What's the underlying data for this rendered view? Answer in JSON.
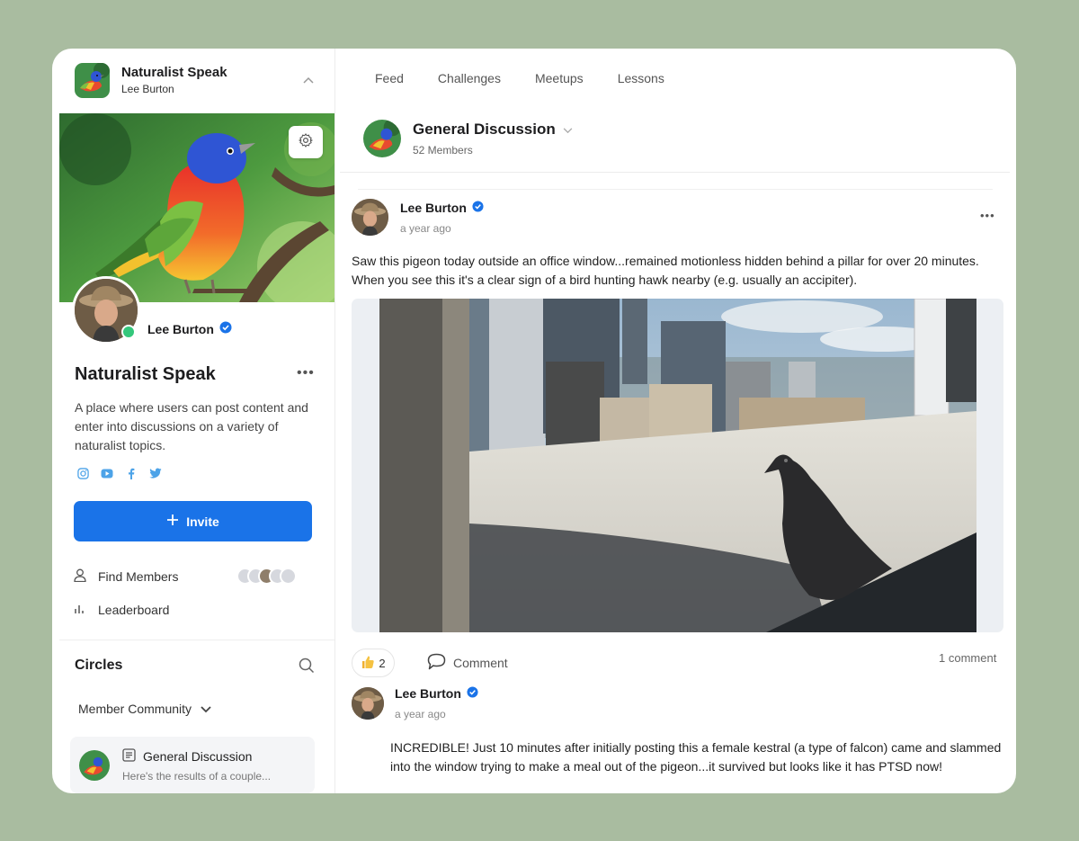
{
  "sidebar": {
    "app_name": "Naturalist Speak",
    "user_name": "Lee Burton",
    "profile_name": "Lee Burton",
    "community_title": "Naturalist Speak",
    "community_description": "A place where users can post content and enter into discussions on a variety of naturalist topics.",
    "socials": [
      "instagram-icon",
      "youtube-icon",
      "facebook-icon",
      "twitter-icon"
    ],
    "invite_label": "Invite",
    "find_members_label": "Find Members",
    "leaderboard_label": "Leaderboard",
    "circles_title": "Circles",
    "member_community_label": "Member Community",
    "circle_item": {
      "title": "General Discussion",
      "preview": "Here's the results of a couple..."
    }
  },
  "tabs": [
    {
      "label": "Feed"
    },
    {
      "label": "Challenges"
    },
    {
      "label": "Meetups"
    },
    {
      "label": "Lessons"
    }
  ],
  "group": {
    "name": "General Discussion",
    "members": "52 Members"
  },
  "post": {
    "author": "Lee Burton",
    "time": "a year ago",
    "text": "Saw this pigeon today outside an office window...remained motionless hidden behind a pillar for over 20 minutes. When you see this it's a clear sign of a bird hunting hawk nearby (e.g. usually an accipiter).",
    "reaction_count": "2",
    "comment_label": "Comment",
    "comment_count": "1 comment"
  },
  "comment": {
    "author": "Lee Burton",
    "time": "a year ago",
    "text": "INCREDIBLE! Just 10 minutes after initially posting this a female kestral (a type of falcon) came and slammed into the window trying to make a meal out of the pigeon...it survived but looks like it has PTSD now!"
  },
  "colors": {
    "accent": "#1a73e8",
    "background": "#a9bca0",
    "online": "#34c77b",
    "verified": "#1a73e8",
    "social": "#4da3e8"
  }
}
